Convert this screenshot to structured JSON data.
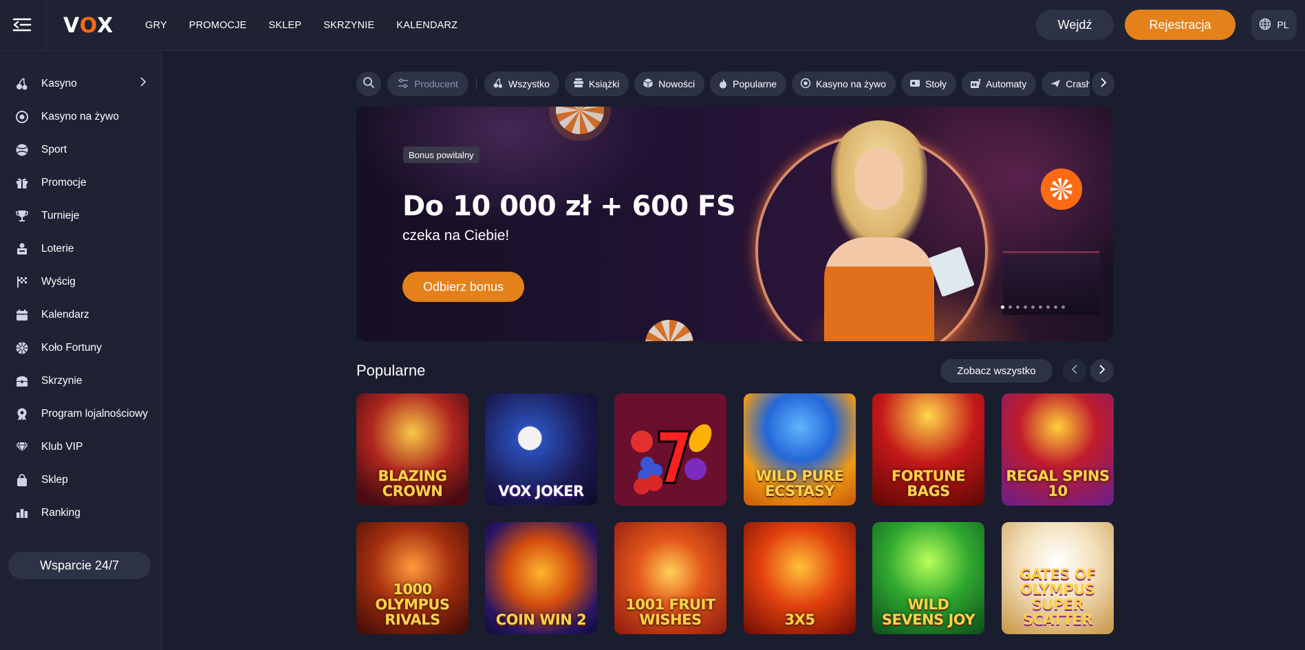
{
  "header": {
    "logo": "VOX",
    "nav": [
      "GRY",
      "PROMOCJE",
      "SKLEP",
      "SKRZYNIE",
      "KALENDARZ"
    ],
    "login_label": "Wejdź",
    "register_label": "Rejestracja",
    "language": "PL"
  },
  "sidebar": {
    "items": [
      {
        "label": "Kasyno",
        "icon": "cherries-icon"
      },
      {
        "label": "Kasyno na żywo",
        "icon": "live-casino-icon"
      },
      {
        "label": "Sport",
        "icon": "ball-icon"
      },
      {
        "label": "Promocje",
        "icon": "gift-icon"
      },
      {
        "label": "Turnieje",
        "icon": "trophy-icon"
      },
      {
        "label": "Loterie",
        "icon": "lottery-icon"
      },
      {
        "label": "Wyścig",
        "icon": "flag-icon"
      },
      {
        "label": "Kalendarz",
        "icon": "calendar-icon"
      },
      {
        "label": "Koło Fortuny",
        "icon": "wheel-icon"
      },
      {
        "label": "Skrzynie",
        "icon": "chest-icon"
      },
      {
        "label": "Program lojalnościowy",
        "icon": "loyalty-icon"
      },
      {
        "label": "Klub VIP",
        "icon": "diamond-icon"
      },
      {
        "label": "Sklep",
        "icon": "bag-icon"
      },
      {
        "label": "Ranking",
        "icon": "ranking-icon"
      }
    ],
    "support_label": "Wsparcie 24/7"
  },
  "categories": {
    "producer_label": "Producent",
    "items": [
      {
        "label": "Wszystko",
        "icon": "cherries-icon"
      },
      {
        "label": "Książki",
        "icon": "books-icon"
      },
      {
        "label": "Nowości",
        "icon": "cube-icon"
      },
      {
        "label": "Popularne",
        "icon": "fire-icon"
      },
      {
        "label": "Kasyno na żywo",
        "icon": "live-casino-icon"
      },
      {
        "label": "Stoły",
        "icon": "table-icon"
      },
      {
        "label": "Automaty",
        "icon": "slot-icon"
      },
      {
        "label": "Crash",
        "icon": "plane-icon"
      }
    ]
  },
  "banner": {
    "badge": "Bonus powitalny",
    "title": "Do 10 000 zł + 600 FS",
    "subtitle": "czeka na Ciebie!",
    "cta_label": "Odbierz bonus",
    "slides_total": 9,
    "slide_active": 1
  },
  "popular": {
    "title": "Popularne",
    "see_all_label": "Zobacz wszystko",
    "games": [
      {
        "name": "BLAZING CROWN"
      },
      {
        "name": "VOX JOKER"
      },
      {
        "name": ""
      },
      {
        "name": "WILD PURE ECSTASY"
      },
      {
        "name": "FORTUNE BAGS"
      },
      {
        "name": "REGAL SPINS 10"
      },
      {
        "name": "1000 OLYMPUS RIVALS"
      },
      {
        "name": "COIN WIN 2"
      },
      {
        "name": "1001 FRUIT WISHES"
      },
      {
        "name": "3X5"
      },
      {
        "name": "WILD SEVENS JOY"
      },
      {
        "name": "GATES OF OLYMPUS SUPER SCATTER"
      }
    ]
  },
  "colors": {
    "accent": "#e4811b",
    "background": "#1a1d2e",
    "panel": "#1f2233",
    "pill": "#2d3246"
  }
}
